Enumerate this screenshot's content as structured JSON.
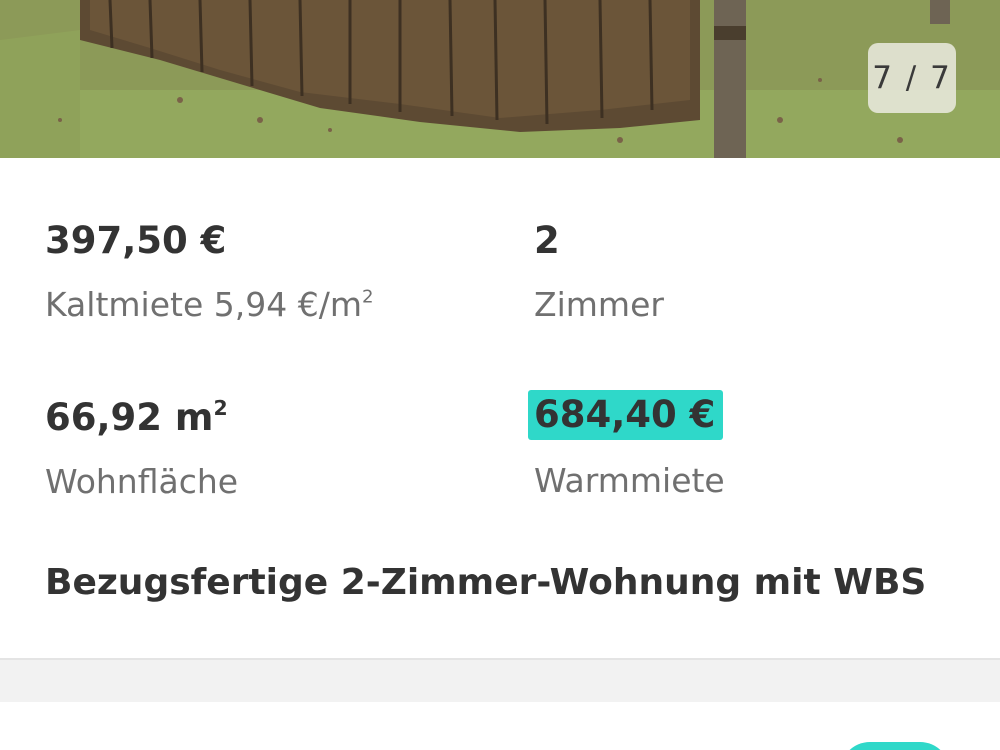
{
  "gallery": {
    "counter": "7 / 7"
  },
  "listing": {
    "kaltmiete": {
      "value": "397,50 €",
      "label": "Kaltmiete 5,94 €/m",
      "label_sup": "2"
    },
    "zimmer": {
      "value": "2",
      "label": "Zimmer"
    },
    "wohnflaeche": {
      "value": "66,92 m",
      "value_sup": "2",
      "label": "Wohnfläche"
    },
    "warmmiete": {
      "value": "684,40 €",
      "label": "Warmmiete"
    },
    "title": "Bezugsfertige 2-Zimmer-Wohnung mit WBS"
  },
  "colors": {
    "highlight": "#2fd8c9",
    "text": "#333333",
    "label": "#707070"
  }
}
